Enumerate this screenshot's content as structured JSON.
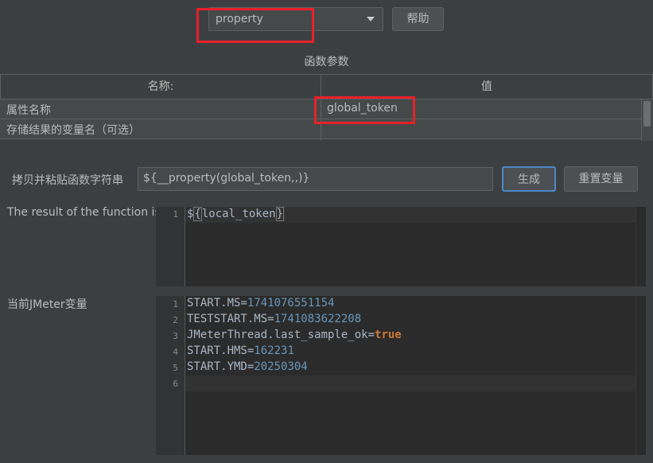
{
  "function_select": {
    "value": "property"
  },
  "help_button": "帮助",
  "params_section_title": "函数参数",
  "params_table": {
    "columns": [
      "名称:",
      "值"
    ],
    "rows": [
      {
        "name": "属性名称",
        "value": "global_token"
      },
      {
        "name": "存储结果的变量名（可选）",
        "value": ""
      }
    ]
  },
  "copy_label": "拷贝并粘贴函数字符串",
  "function_string": "${__property(global_token,,)}",
  "generate_button": "生成",
  "reset_button": "重置变量",
  "result_label": "The result of the function is",
  "result_editor": {
    "lines": [
      {
        "no": "1",
        "text": "${local_token}"
      }
    ]
  },
  "vars_label": "当前JMeter变量",
  "vars_editor": {
    "lines": [
      {
        "no": "1",
        "key": "START.MS=",
        "value": "1741076551154"
      },
      {
        "no": "2",
        "key": "TESTSTART.MS=",
        "value": "1741083622208"
      },
      {
        "no": "3",
        "key": "JMeterThread.last_sample_ok=",
        "value": "true"
      },
      {
        "no": "4",
        "key": "START.HMS=",
        "value": "162231"
      },
      {
        "no": "5",
        "key": "START.YMD=",
        "value": "20250304"
      },
      {
        "no": "6",
        "key": "",
        "value": ""
      }
    ]
  },
  "colors": {
    "background": "#3c3f41",
    "editor_background": "#2b2b2b",
    "highlight_border": "#e8202a",
    "number": "#6897bb",
    "keyword": "#cc7832"
  }
}
